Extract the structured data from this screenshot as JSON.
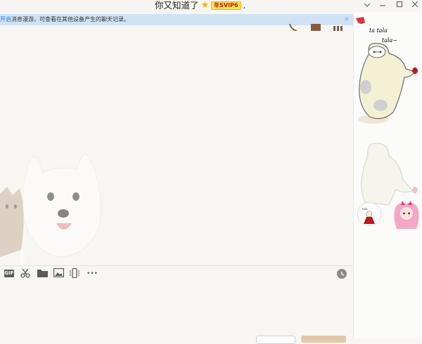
{
  "window": {
    "title": "你又知道了",
    "badge": "年SVIP6",
    "title_suffix": ".",
    "controls": [
      "chevron-down-icon",
      "minimize-icon",
      "maximize-icon",
      "close-icon"
    ]
  },
  "notice": {
    "link_text": "开启",
    "text": "消息漫游，可查看在其他设备产生的聊天记录。",
    "close": "×"
  },
  "toolbar": {
    "items": [
      "gif-icon",
      "scissors-icon",
      "folder-icon",
      "image-icon",
      "shake-icon",
      "more-icon"
    ],
    "gif_label": "GIF",
    "more_label": "•••",
    "history": "clock-icon"
  },
  "sticker": {
    "line1": "ta tala",
    "line2": "tala~"
  },
  "colors": {
    "notice_bg": "#cfe3f4",
    "link": "#1e7ad6",
    "badge_bg": "#ffe34d",
    "badge_text": "#c5141a",
    "send_button": "#e3c8a6"
  }
}
